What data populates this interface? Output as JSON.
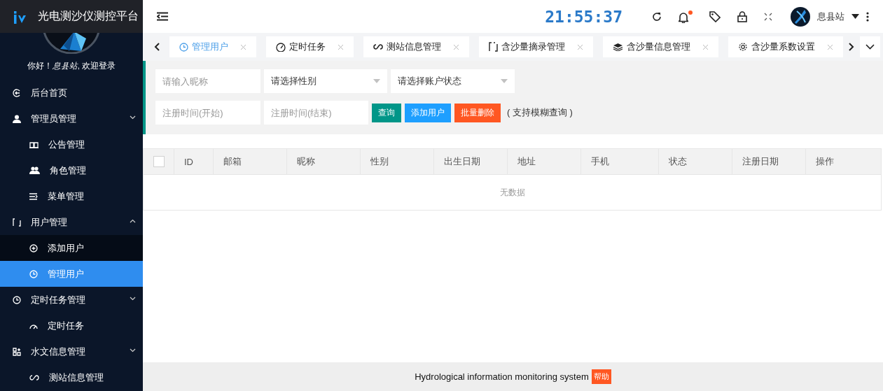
{
  "sidebar": {
    "title": "光电测沙仪测控平台",
    "greeting": "你好！*息县站*, 欢迎登录",
    "menu": [
      {
        "label": "后台首页",
        "selected": false
      },
      {
        "label": "管理员管理",
        "selected": false,
        "expanded": false,
        "children": [
          {
            "label": "公告管理",
            "selected": false
          },
          {
            "label": "角色管理",
            "selected": false
          },
          {
            "label": "菜单管理",
            "selected": false
          }
        ]
      },
      {
        "label": "用户管理",
        "selected": false,
        "expanded": true,
        "children": [
          {
            "label": "添加用户",
            "selected": false
          },
          {
            "label": "管理用户",
            "selected": true
          }
        ]
      },
      {
        "label": "定时任务管理",
        "selected": false,
        "expanded": false,
        "children": [
          {
            "label": "定时任务",
            "selected": false
          }
        ]
      },
      {
        "label": "水文信息管理",
        "selected": false,
        "expanded": false,
        "children": [
          {
            "label": "测站信息管理",
            "selected": false
          }
        ]
      }
    ]
  },
  "header": {
    "clock": "21:55:37",
    "unread": true,
    "user": "息县站"
  },
  "tabs": [
    {
      "label": "管理用户",
      "selected": true
    },
    {
      "label": "定时任务",
      "selected": false
    },
    {
      "label": "测站信息管理",
      "selected": false
    },
    {
      "label": "含沙量摘录管理",
      "selected": false
    },
    {
      "label": "含沙量信息管理",
      "selected": false
    },
    {
      "label": "含沙量系数设置",
      "selected": false
    }
  ],
  "filters": {
    "nickname": {
      "placeholder": "请输入昵称"
    },
    "gender": {
      "value": "请选择性别"
    },
    "status": {
      "value": "请选择账户状态"
    },
    "start": {
      "placeholder": "注册时间(开始)"
    },
    "end": {
      "placeholder": "注册时间(结束)"
    }
  },
  "buttons": [
    {
      "label": "查询",
      "kind": "search"
    },
    {
      "label": "添加用户",
      "kind": "add"
    },
    {
      "label": "批量删除",
      "kind": "delete"
    }
  ],
  "note": "( 支持模糊查询 )",
  "table": {
    "select_all": false,
    "columns": [
      "ID",
      "邮箱",
      "昵称",
      "性别",
      "出生日期",
      "地址",
      "手机",
      "状态",
      "注册日期",
      "操作"
    ],
    "empty_text": "无数据"
  },
  "footer": {
    "text": "Hydrological information monitoring system",
    "help": "帮助"
  }
}
